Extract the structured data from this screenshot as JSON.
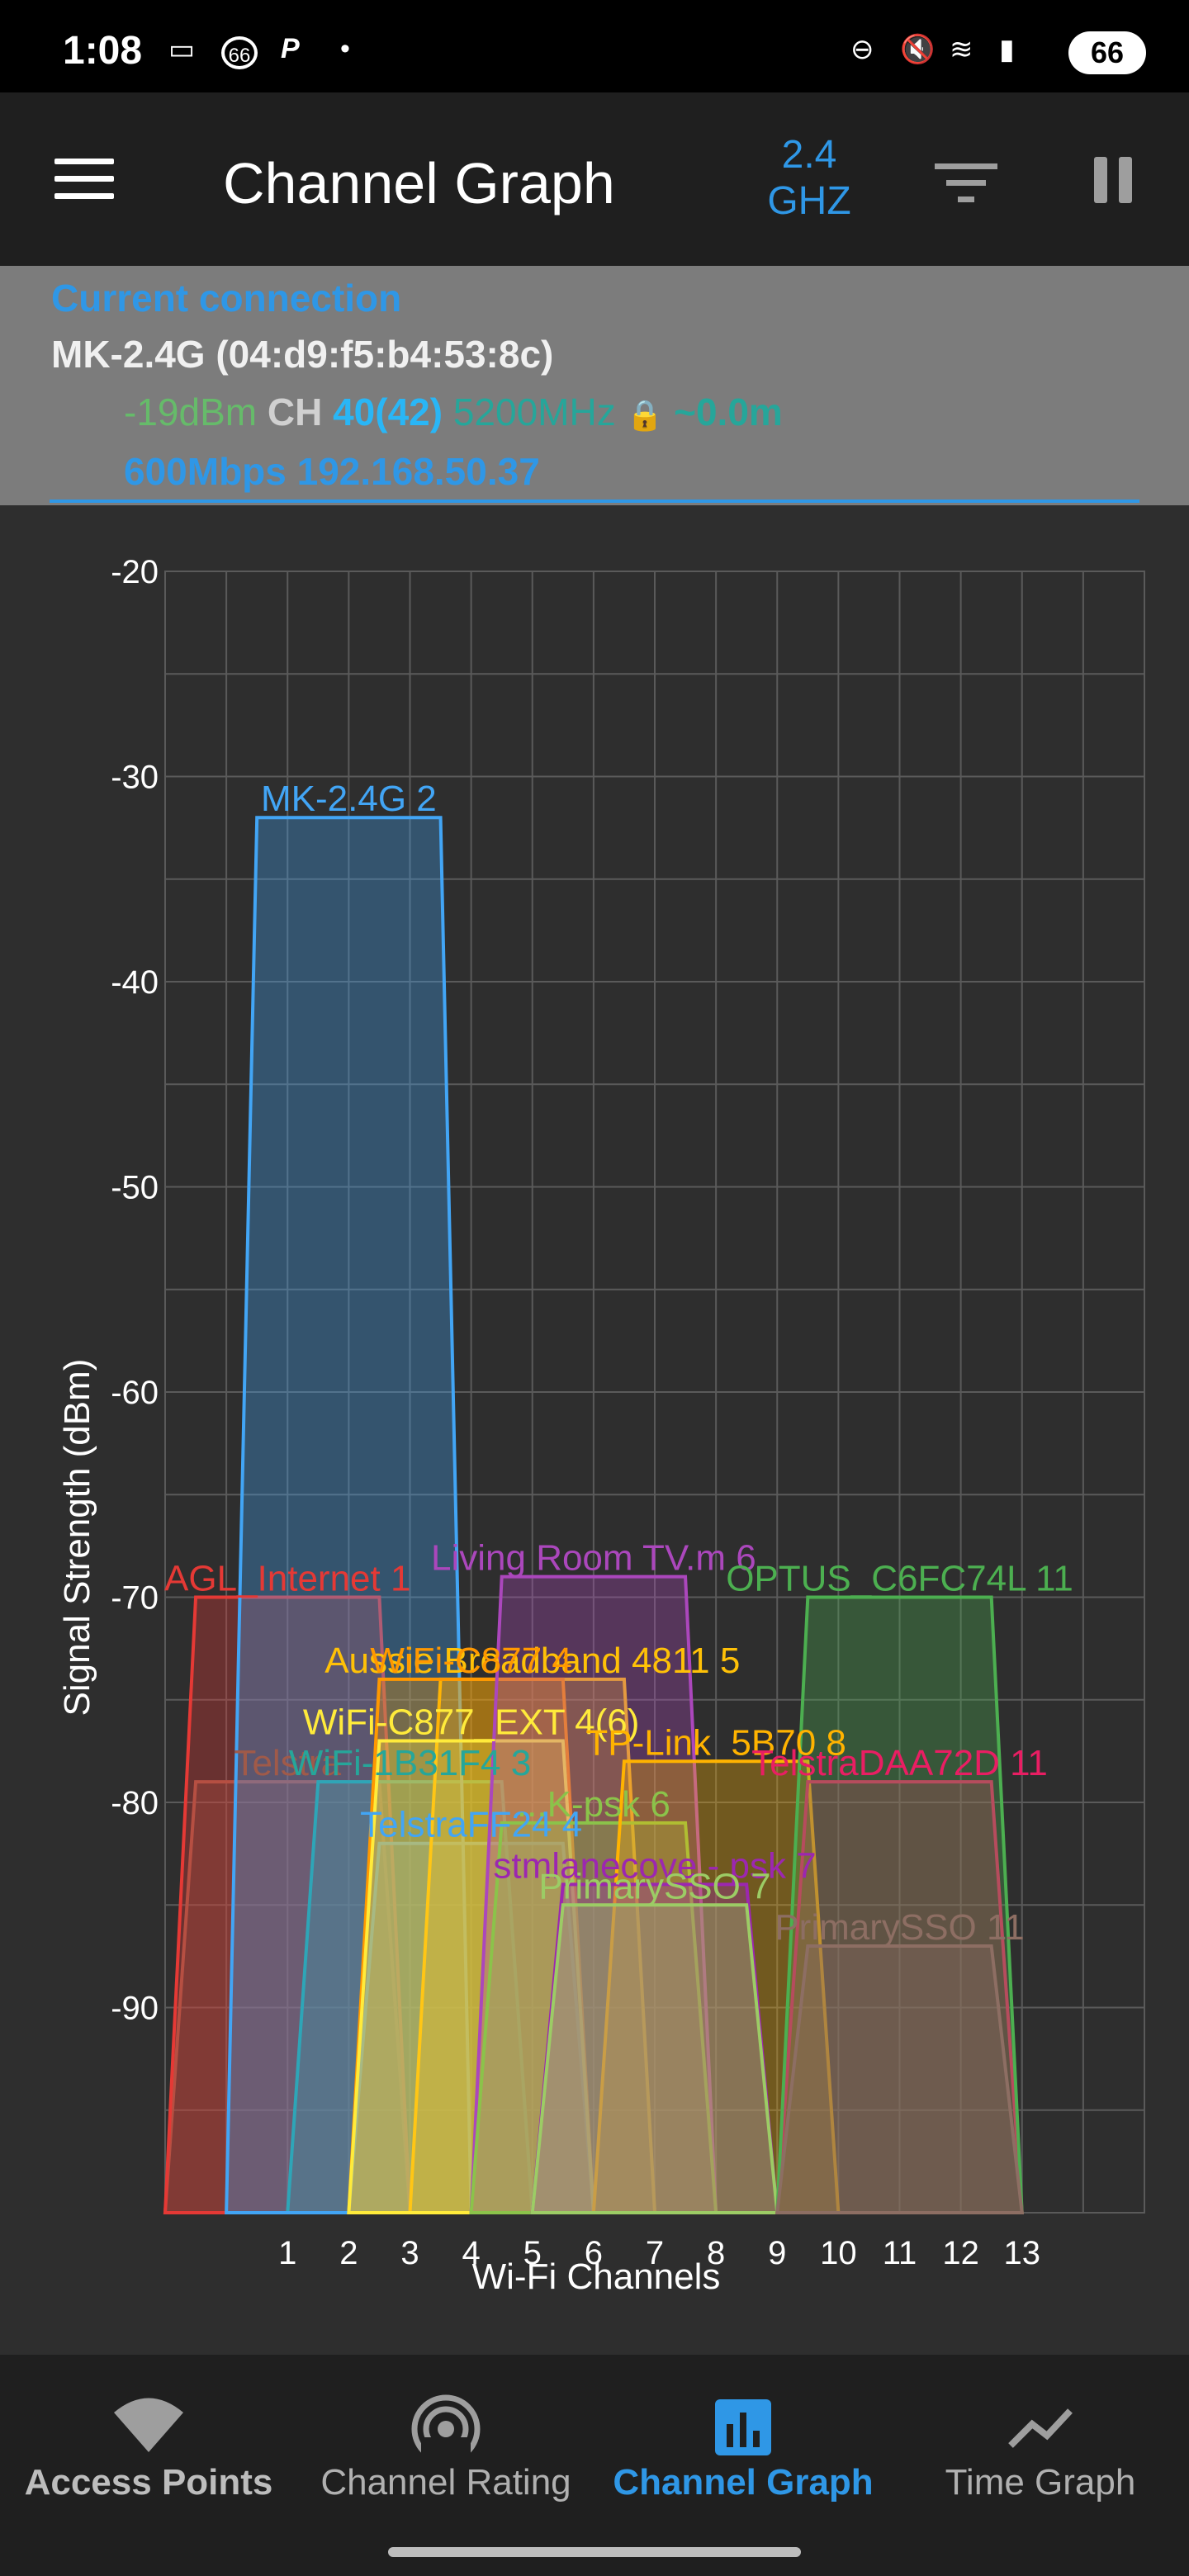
{
  "status_bar": {
    "time": "1:08",
    "badge": "66",
    "battery": "66"
  },
  "app_bar": {
    "title": "Channel Graph",
    "band_line1": "2.4",
    "band_line2": "GHZ"
  },
  "connection": {
    "heading": "Current connection",
    "ssid": "MK-2.4G (04:d9:f5:b4:53:8c)",
    "signal": "-19dBm",
    "ch_label": "CH",
    "channel": "40(42)",
    "frequency": "5200MHz",
    "distance": "~0.0m",
    "rate_ip": "600Mbps 192.168.50.37"
  },
  "chart_data": {
    "type": "area",
    "xlabel": "Wi-Fi Channels",
    "ylabel": "Signal Strength (dBm)",
    "x_ticks": [
      "1",
      "2",
      "3",
      "4",
      "5",
      "6",
      "7",
      "8",
      "9",
      "10",
      "11",
      "12",
      "13"
    ],
    "y_ticks": [
      "-20",
      "-30",
      "-40",
      "-50",
      "-60",
      "-70",
      "-80",
      "-90"
    ],
    "ylim": [
      -100,
      -20
    ],
    "xlim": [
      -1,
      15
    ],
    "grid": true,
    "series": [
      {
        "name": "Telstra",
        "label": "Telstra",
        "channel": 1,
        "width": 4,
        "signal": -79,
        "color": "#a05a49"
      },
      {
        "name": "AGL_Internet",
        "label": "AGL_Internet 1",
        "channel": 1,
        "width": 4,
        "signal": -70,
        "color": "#e53935"
      },
      {
        "name": "WiFi-1B31F4",
        "label": "WiFi-1B31F4 3",
        "channel": 3,
        "width": 4,
        "signal": -79,
        "color": "#26a69a"
      },
      {
        "name": "MK-2.4G",
        "label": "MK-2.4G 2",
        "channel": 2,
        "width": 4,
        "signal": -32,
        "color": "#42a5f5"
      },
      {
        "name": "TelstraFF24",
        "label": "TelstraFF24 4",
        "channel": 4,
        "width": 4,
        "signal": -82,
        "color": "#42a5f5"
      },
      {
        "name": "Aussie Broadband 4811",
        "label": "Aussie Broadband 4811 5",
        "channel": 5,
        "width": 4,
        "signal": -74,
        "color": "#ffc107"
      },
      {
        "name": "WiFi-C877",
        "label": "WiFi-C877 4",
        "channel": 4,
        "width": 4,
        "signal": -74,
        "color": "#ff9800"
      },
      {
        "name": "WiFi-C877_EXT",
        "label": "WiFi-C877_EXT 4(6)",
        "channel": 4,
        "width": 4,
        "signal": -77,
        "color": "#ffeb3b"
      },
      {
        "name": "Living Room TV.m",
        "label": "Living Room TV.m 6",
        "channel": 6,
        "width": 4,
        "signal": -69,
        "color": "#ab47bc"
      },
      {
        "name": "...K-psk",
        "label": "...K-psk 6",
        "channel": 6,
        "width": 4,
        "signal": -81,
        "color": "#8bc34a"
      },
      {
        "name": "TP-Link_5B70",
        "label": "TP-Link_5B70 8",
        "channel": 8,
        "width": 4,
        "signal": -78,
        "color": "#ffb300"
      },
      {
        "name": "stmlanecove - psk",
        "label": "stmlanecove - psk 7",
        "channel": 7,
        "width": 4,
        "signal": -84,
        "color": "#9c27b0"
      },
      {
        "name": "PrimarySSO",
        "label": "PrimarySSO 7",
        "channel": 7,
        "width": 4,
        "signal": -85,
        "color": "#9ccc65"
      },
      {
        "name": "TelstraDAA72D",
        "label": "TelstraDAA72D 11",
        "channel": 11,
        "width": 4,
        "signal": -79,
        "color": "#e91e63"
      },
      {
        "name": "OPTUS_C6FC74L",
        "label": "OPTUS_C6FC74L 11",
        "channel": 11,
        "width": 4,
        "signal": -70,
        "color": "#4caf50"
      },
      {
        "name": "PrimarySSO 11",
        "label": "PrimarySSO 11",
        "channel": 11,
        "width": 4,
        "signal": -87,
        "color": "#8d6e63"
      }
    ]
  },
  "bottom_nav": {
    "items": [
      {
        "label": "Access Points"
      },
      {
        "label": "Channel Rating"
      },
      {
        "label": "Channel Graph"
      },
      {
        "label": "Time Graph"
      }
    ]
  }
}
